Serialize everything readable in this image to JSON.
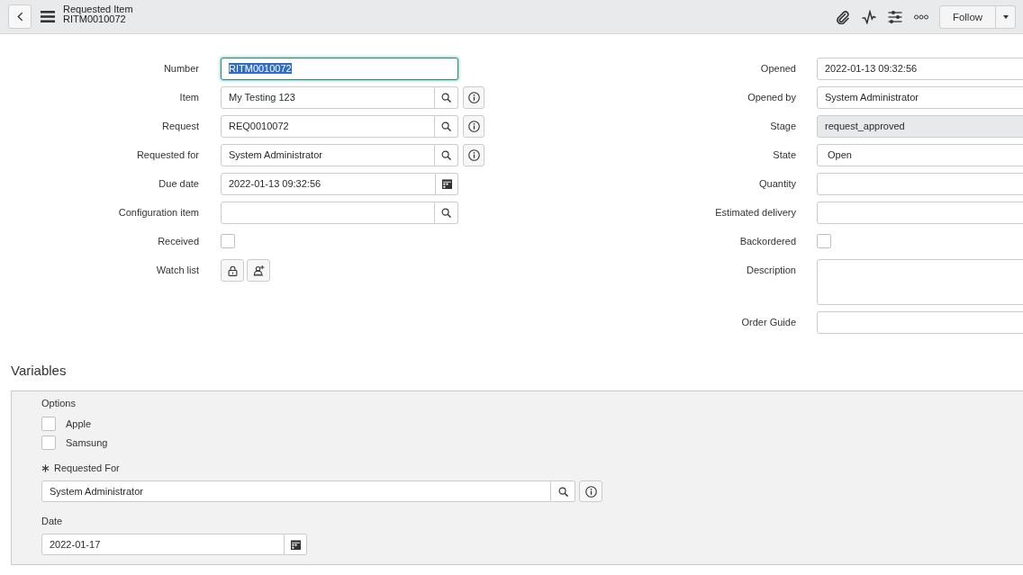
{
  "header": {
    "title": "Requested Item",
    "record_number": "RITM0010072",
    "follow_button": "Follow"
  },
  "form": {
    "left_fields": [
      {
        "kind": "text",
        "label": "Number",
        "value": "RITM0010072",
        "focused": true,
        "readonly": false
      },
      {
        "kind": "reference",
        "label": "Item",
        "value": "My Testing 123",
        "focused": false,
        "readonly": false
      },
      {
        "kind": "reference",
        "label": "Request",
        "value": "REQ0010072",
        "focused": false,
        "readonly": false
      },
      {
        "kind": "reference",
        "label": "Requested for",
        "value": "System Administrator",
        "focused": false,
        "readonly": false
      },
      {
        "kind": "date",
        "label": "Due date",
        "value": "2022-01-13 09:32:56",
        "focused": false,
        "readonly": false
      },
      {
        "kind": "lookup",
        "label": "Configuration item",
        "focused": false,
        "readonly": false
      },
      {
        "kind": "checkbox",
        "label": "Received",
        "checked": false
      },
      {
        "kind": "watchlist",
        "label": "Watch list"
      }
    ],
    "right_fields": [
      {
        "kind": "text",
        "label": "Opened",
        "value": "2022-01-13 09:32:56",
        "focused": false,
        "readonly": false
      },
      {
        "kind": "text",
        "label": "Opened by",
        "value": "System Administrator",
        "focused": false,
        "readonly": false
      },
      {
        "kind": "text",
        "label": "Stage",
        "value": "request_approved",
        "focused": false,
        "readonly": true
      },
      {
        "kind": "select",
        "label": "State",
        "value": "Open",
        "focused": false,
        "readonly": false
      },
      {
        "kind": "text",
        "label": "Quantity",
        "focused": false,
        "readonly": false
      },
      {
        "kind": "text",
        "label": "Estimated delivery",
        "focused": false,
        "readonly": false
      },
      {
        "kind": "checkbox",
        "label": "Backordered",
        "checked": false
      },
      {
        "kind": "textarea",
        "label": "Description",
        "focused": false,
        "readonly": false
      },
      {
        "kind": "text",
        "label": "Order Guide",
        "focused": false,
        "readonly": false
      }
    ]
  },
  "variables": {
    "title": "Variables",
    "fields": [
      {
        "kind": "checkbox_group",
        "label": "Options",
        "options": [
          {
            "label": "Apple",
            "checked": false
          },
          {
            "label": "Samsung",
            "checked": false
          }
        ]
      },
      {
        "kind": "reference",
        "label": "Requested For",
        "required": true,
        "value": "System Administrator"
      },
      {
        "kind": "date",
        "label": "Date",
        "required": false,
        "value": "2022-01-17"
      }
    ]
  }
}
